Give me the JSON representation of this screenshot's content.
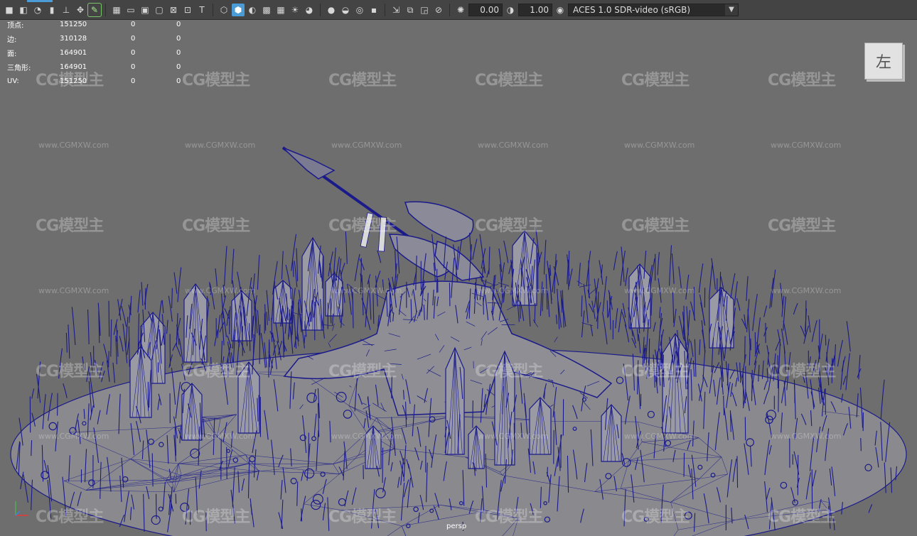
{
  "toolbar": {
    "icons": [
      "camera-icon",
      "camera-attr-icon",
      "bookmark-icon",
      "pin-icon",
      "grid-icon",
      "transform-icon",
      "pencil-icon",
      "layout-single-icon",
      "layout-film-icon",
      "layout-resolution-icon",
      "layout-safe-icon",
      "layout-field-icon",
      "layout-text-icon",
      "wireframe-cube-icon",
      "shaded-cube-icon",
      "smooth-shade-icon",
      "textured-icon",
      "light-icon",
      "shadow-icon",
      "ao-icon",
      "motion-blur-icon",
      "aa-icon",
      "gate-icon",
      "select-icon",
      "isolate-icon",
      "xray-icon",
      "xray-joint-icon",
      "exposure-icon",
      "gamma-icon",
      "color-space-icon"
    ],
    "exposure_value": "0.00",
    "gamma_value": "1.00",
    "color_space": "ACES 1.0 SDR-video (sRGB)"
  },
  "hud": {
    "rows": [
      {
        "label": "顶点:",
        "v1": "151250",
        "v2": "0",
        "v3": "0"
      },
      {
        "label": "边:",
        "v1": "310128",
        "v2": "0",
        "v3": "0"
      },
      {
        "label": "面:",
        "v1": "164901",
        "v2": "0",
        "v3": "0"
      },
      {
        "label": "三角形:",
        "v1": "164901",
        "v2": "0",
        "v3": "0"
      },
      {
        "label": "UV:",
        "v1": "151250",
        "v2": "0",
        "v3": "0"
      }
    ]
  },
  "viewcube": {
    "label": "左"
  },
  "viewport": {
    "camera": "persp"
  },
  "watermark": {
    "logo": "CG模型主",
    "url": "www.CGMXW.com"
  },
  "colors": {
    "wire": "#1a1a8a",
    "background": "#6e6e6e",
    "toolbar": "#444444",
    "accent": "#4b9bd6"
  }
}
